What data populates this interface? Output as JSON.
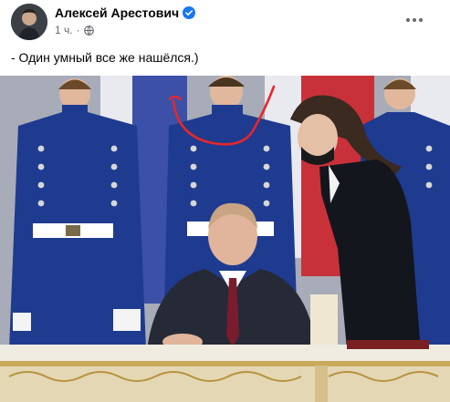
{
  "post": {
    "author_name": "Алексей Арестович",
    "verified": true,
    "timestamp": "1 ч.",
    "audience_icon": "globe-icon",
    "more_icon": "more-options-icon",
    "text": "- Один умный все же нашёлся.)"
  },
  "colors": {
    "verified_badge": "#1877f2",
    "meta_text": "#65676b",
    "annotation_stroke": "#e8262a",
    "uniform_blue": "#1f3b8f"
  }
}
